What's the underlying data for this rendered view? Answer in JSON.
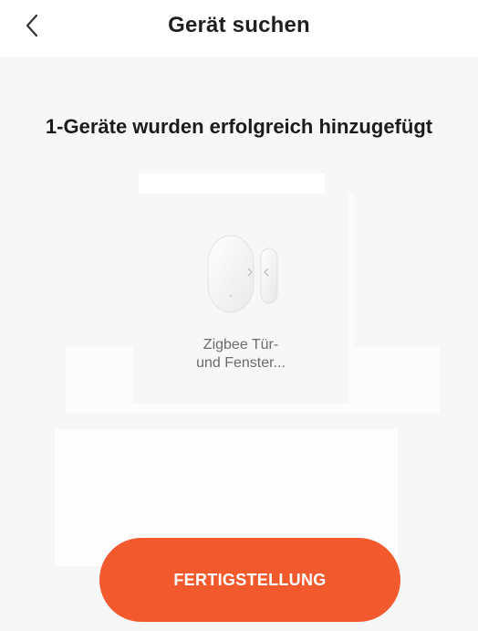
{
  "header": {
    "back_icon": "chevron-left-icon",
    "title": "Gerät suchen"
  },
  "main": {
    "success_message": "1-Geräte wurden erfolgreich hinzugefügt",
    "device": {
      "icon": "door-window-sensor-icon",
      "name_line1": "Zigbee Tür-",
      "name_line2": "und Fenster..."
    },
    "finish_label": "FERTIGSTELLUNG"
  },
  "colors": {
    "accent": "#f2592d",
    "background": "#f7f7f7",
    "title_text": "#1f1f1f",
    "secondary_text": "#6b6b6b"
  }
}
